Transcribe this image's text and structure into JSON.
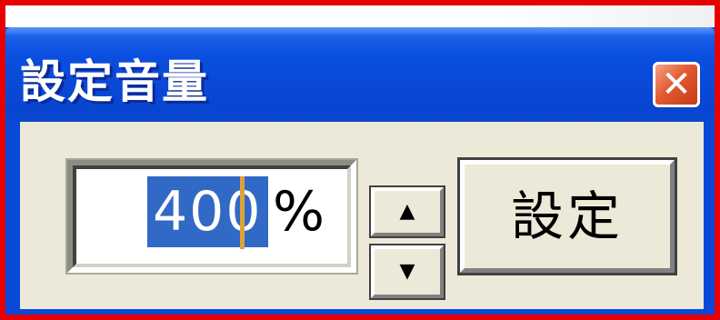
{
  "window": {
    "title": "設定音量",
    "close_glyph": "✕"
  },
  "volume": {
    "value": "400",
    "unit": "%",
    "selected": true
  },
  "spinner": {
    "up_glyph": "▲",
    "down_glyph": "▼"
  },
  "actions": {
    "set_label": "設定"
  },
  "colors": {
    "frame": "#e60000",
    "titlebar": "#0a4fe0",
    "close": "#e25a32",
    "client": "#ece9d8",
    "selection": "#3169c6"
  }
}
